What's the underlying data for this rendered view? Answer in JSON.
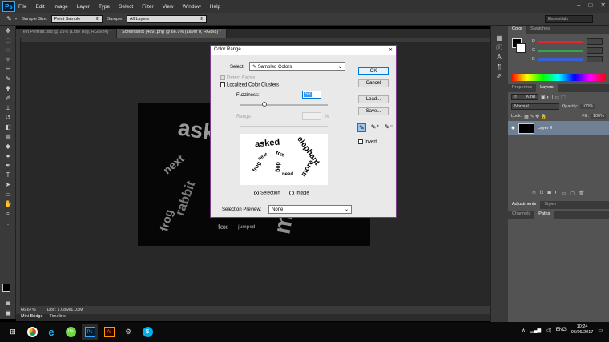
{
  "app": {
    "logo": "Ps"
  },
  "menu": [
    "File",
    "Edit",
    "Image",
    "Layer",
    "Type",
    "Select",
    "Filter",
    "View",
    "Window",
    "Help"
  ],
  "window_controls": {
    "minimize": "–",
    "maximize": "□",
    "close": "✕"
  },
  "options_bar": {
    "sample_size_label": "Sample Size:",
    "sample_size_value": "Point Sample",
    "sample_label": "Sample:",
    "sample_value": "All Layers",
    "workspace": "Essentials"
  },
  "tabs": [
    {
      "label": "Text Portrait.psd @ 25% (Little Boy, RGB/8#) *"
    },
    {
      "label": "Screenshot (489).png @ 66.7% (Layer 0, RGB/8) *"
    }
  ],
  "canvas_words": [
    "asked",
    "next",
    "rabbit",
    "frog",
    "elephant",
    "more",
    "fox",
    "need",
    "dog",
    "jumped"
  ],
  "status": {
    "zoom": "66.67%",
    "doc": "Doc: 1.08M/1.03M"
  },
  "bottom_tabs": [
    "Mini Bridge",
    "Timeline"
  ],
  "color_panel": {
    "tabs": [
      "Color",
      "Swatches"
    ],
    "channels": [
      "R",
      "G",
      "B"
    ],
    "colors": {
      "r": "#e0282e",
      "g": "#2ea84a",
      "b": "#3a5fd0"
    }
  },
  "layers_panel": {
    "tabs": [
      "Properties",
      "Layers"
    ],
    "kind": "Kind",
    "blend": "Normal",
    "opacity_label": "Opacity:",
    "opacity": "100%",
    "lock_label": "Lock:",
    "fill_label": "Fill:",
    "fill": "100%",
    "layer_name": "Layer 0"
  },
  "adjust_tabs": [
    "Adjustments",
    "Styles"
  ],
  "channel_tabs": [
    "Channels",
    "Paths"
  ],
  "dialog": {
    "title": "Color Range",
    "close": "✕",
    "select_label": "Select:",
    "select_value": "Sampled Colors",
    "detect_faces": "Detect Faces",
    "localized": "Localized Color Clusters",
    "fuzziness_label": "Fuzziness:",
    "fuzziness_value": "58",
    "range_label": "Range:",
    "range_unit": "%",
    "ok": "OK",
    "cancel": "Cancel",
    "load": "Load...",
    "save": "Save...",
    "invert": "Invert",
    "selection": "Selection",
    "image": "Image",
    "preview_label": "Selection Preview:",
    "preview_value": "None",
    "preview_words": [
      "asked",
      "elephant",
      "fox",
      "more",
      "dog",
      "frog",
      "next",
      "need"
    ]
  },
  "taskbar": {
    "apps": [
      "chrome",
      "ie",
      "upwork",
      "Ps",
      "Ai",
      "steam",
      "skype"
    ],
    "lang": "ENG",
    "time": "10:24",
    "date": "06/06/2017"
  }
}
